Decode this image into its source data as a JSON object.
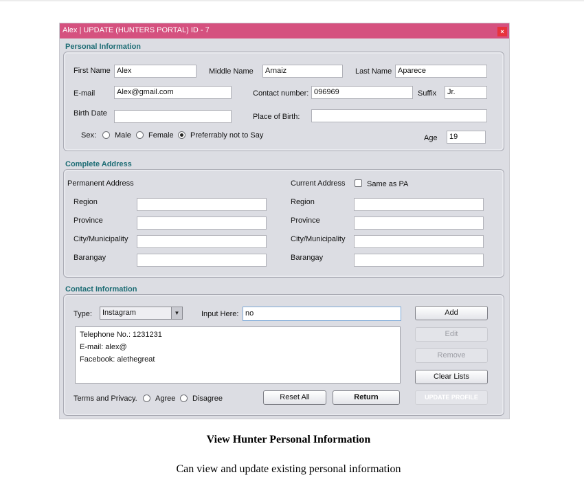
{
  "window": {
    "title": "Alex | UPDATE (HUNTERS PORTAL)   ID - 7",
    "close_glyph": "×"
  },
  "personal": {
    "section_title": "Personal Information",
    "first_name_label": "First Name",
    "first_name": "Alex",
    "middle_name_label": "Middle Name",
    "middle_name": "Arnaiz",
    "last_name_label": "Last Name",
    "last_name": "Aparece",
    "email_label": "E-mail",
    "email": "Alex@gmail.com",
    "contact_label": "Contact number:",
    "contact": "096969",
    "suffix_label": "Suffix",
    "suffix": "Jr.",
    "birth_date_label": "Birth Date",
    "birth_date": "",
    "place_of_birth_label": "Place of Birth:",
    "place_of_birth": "",
    "sex_label": "Sex:",
    "sex_options": [
      "Male",
      "Female",
      "Preferrably not to Say"
    ],
    "sex_selected": "Preferrably not to Say",
    "age_label": "Age",
    "age": "19"
  },
  "address": {
    "section_title": "Complete Address",
    "permanent_label": "Permanent Address",
    "current_label": "Current Address",
    "same_as_pa_label": "Same as PA",
    "same_as_pa_checked": false,
    "permanent": {
      "region_label": "Region",
      "region": "",
      "province_label": "Province",
      "province": "",
      "city_label": "City/Municipality",
      "city": "",
      "barangay_label": "Barangay",
      "barangay": ""
    },
    "current": {
      "region_label": "Region",
      "region": "",
      "province_label": "Province",
      "province": "",
      "city_label": "City/Municipality",
      "city": "",
      "barangay_label": "Barangay",
      "barangay": ""
    }
  },
  "contact": {
    "section_title": "Contact Information",
    "type_label": "Type:",
    "type_selected": "Instagram",
    "input_label": "Input Here:",
    "input_value": "no",
    "list_items": [
      "Telephone No.: 1231231",
      "E-mail: alex@",
      "Facebook: alethegreat"
    ],
    "add_label": "Add",
    "edit_label": "Edit",
    "remove_label": "Remove",
    "clear_label": "Clear Lists",
    "terms_label": "Terms and Privacy.",
    "agree_label": "Agree",
    "disagree_label": "Disagree",
    "reset_label": "Reset All",
    "return_label": "Return",
    "update_label": "UPDATE PROFILE"
  },
  "caption": {
    "title": "View Hunter Personal Information",
    "description": "Can view and update existing personal information"
  },
  "colors": {
    "titlebar": "#d5517f",
    "section_title": "#1c6c74",
    "close": "#e8333c"
  },
  "icons": {
    "close": "close-icon",
    "dropdown": "chevron-down-icon"
  }
}
